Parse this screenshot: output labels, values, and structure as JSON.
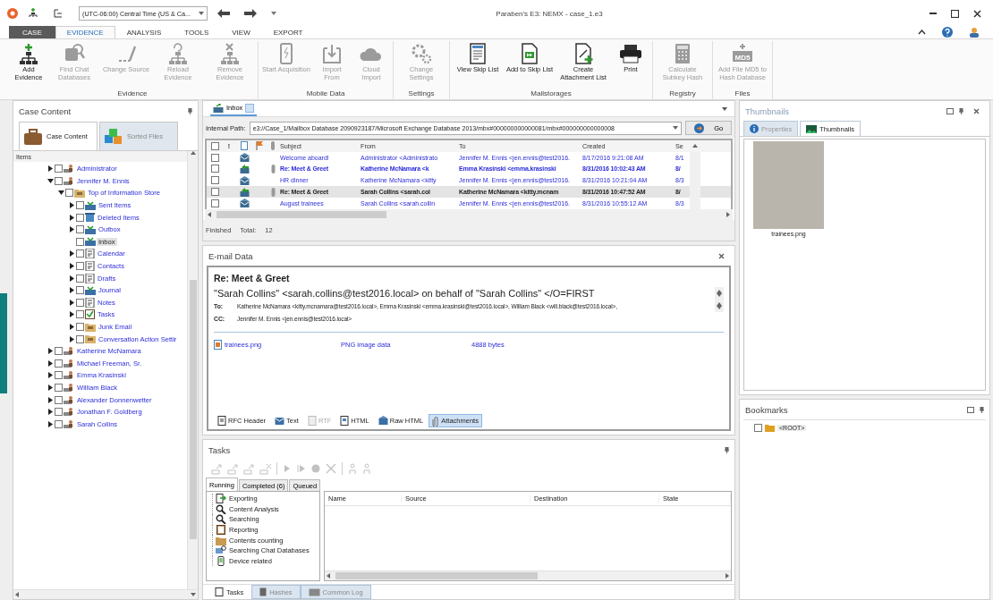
{
  "title_bar": {
    "timezone": "(UTC-06:00) Central Time (US & Ca...",
    "title": "Paraben's E3: NEMX - case_1.e3"
  },
  "ribbon_tabs": [
    {
      "label": "CASE",
      "kind": "file",
      "selected": false
    },
    {
      "label": "EVIDENCE",
      "kind": "tab",
      "selected": true
    },
    {
      "label": "ANALYSIS",
      "kind": "tab",
      "selected": false
    },
    {
      "label": "TOOLS",
      "kind": "tab",
      "selected": false
    },
    {
      "label": "VIEW",
      "kind": "tab",
      "selected": false
    },
    {
      "label": "EXPORT",
      "kind": "tab",
      "selected": false
    }
  ],
  "ribbon_groups": [
    {
      "label": "Evidence",
      "buttons": [
        {
          "label": "Add Evidence",
          "kind": "tree-add",
          "disabled": false
        },
        {
          "label": "Find Chat Databases",
          "kind": "chat-db",
          "disabled": true
        },
        {
          "label": "Change Source",
          "kind": "source",
          "disabled": true
        },
        {
          "label": "Reload Evidence",
          "kind": "tree-reload",
          "disabled": true
        },
        {
          "label": "Remove Evidence",
          "kind": "tree-remove",
          "disabled": true
        }
      ]
    },
    {
      "label": "Mobile Data",
      "buttons": [
        {
          "label": "Start Acquisition",
          "kind": "phone",
          "disabled": true
        },
        {
          "label": "Import From",
          "kind": "import",
          "disabled": true
        },
        {
          "label": "Cloud Import",
          "kind": "cloud",
          "disabled": true
        }
      ]
    },
    {
      "label": "Settings",
      "buttons": [
        {
          "label": "Change Settings",
          "kind": "gears",
          "disabled": true
        }
      ]
    },
    {
      "label": "Mailstorages",
      "buttons": [
        {
          "label": "View Skip List",
          "kind": "list",
          "disabled": false
        },
        {
          "label": "Add to Skip List",
          "kind": "skip-add",
          "disabled": false
        },
        {
          "label": "Create Attachment List",
          "kind": "attach-list",
          "disabled": false
        },
        {
          "label": "Print",
          "kind": "printer",
          "disabled": false
        }
      ]
    },
    {
      "label": "Registry",
      "buttons": [
        {
          "label": "Calculate Subkey Hash",
          "kind": "calculator",
          "disabled": true
        }
      ]
    },
    {
      "label": "Files",
      "buttons": [
        {
          "label": "Add File MD5 to Hash Database",
          "kind": "md5",
          "icon_text": "MD5",
          "disabled": true
        }
      ]
    }
  ],
  "case_content": {
    "title": "Case Content",
    "tabs": [
      {
        "label": "Case Content",
        "selected": true
      },
      {
        "label": "Sorted Files",
        "selected": false
      }
    ],
    "header": "Items",
    "tree": [
      {
        "label": "Administrator",
        "kind": "mailbox",
        "expanded": false,
        "checked": false,
        "selected": false
      },
      {
        "label": "Jennifer M. Ennis",
        "kind": "mailbox",
        "expanded": true,
        "checked": false,
        "selected": false,
        "children": [
          {
            "label": "Top of Information Store",
            "kind": "folder",
            "expanded": true,
            "checked": false,
            "selected": false,
            "children": [
              {
                "label": "Sent Items",
                "kind": "tray",
                "expanded": false,
                "checked": false,
                "selected": false
              },
              {
                "label": "Deleted Items",
                "kind": "bin",
                "expanded": false,
                "checked": false,
                "selected": false
              },
              {
                "label": "Outbox",
                "kind": "tray",
                "expanded": false,
                "checked": false,
                "selected": false
              },
              {
                "label": "Inbox",
                "kind": "tray",
                "checked": false,
                "selected": true
              },
              {
                "label": "Calendar",
                "kind": "page",
                "expanded": false,
                "checked": false,
                "selected": false
              },
              {
                "label": "Contacts",
                "kind": "page",
                "expanded": false,
                "checked": false,
                "selected": false
              },
              {
                "label": "Drafts",
                "kind": "page",
                "expanded": false,
                "checked": false,
                "selected": false
              },
              {
                "label": "Journal",
                "kind": "tray",
                "expanded": false,
                "checked": false,
                "selected": false
              },
              {
                "label": "Notes",
                "kind": "page",
                "expanded": false,
                "checked": false,
                "selected": false
              },
              {
                "label": "Tasks",
                "kind": "tasks",
                "expanded": false,
                "checked": false,
                "selected": false
              },
              {
                "label": "Junk Email",
                "kind": "folder",
                "expanded": false,
                "checked": false,
                "selected": false
              },
              {
                "label": "Conversation Action Settir",
                "kind": "folder",
                "expanded": false,
                "checked": false,
                "selected": false
              }
            ]
          }
        ]
      },
      {
        "label": "Katherine McNamara",
        "kind": "mailbox",
        "expanded": false,
        "checked": false,
        "selected": false
      },
      {
        "label": "Michael Freeman, Sr.",
        "kind": "mailbox",
        "expanded": false,
        "checked": false,
        "selected": false
      },
      {
        "label": "Emma Krasinski",
        "kind": "mailbox",
        "expanded": false,
        "checked": false,
        "selected": false
      },
      {
        "label": "William Black",
        "kind": "mailbox",
        "expanded": false,
        "checked": false,
        "selected": false
      },
      {
        "label": "Alexander Donnenwetter",
        "kind": "mailbox",
        "expanded": false,
        "checked": false,
        "selected": false
      },
      {
        "label": "Jonathan F. Goldberg",
        "kind": "mailbox",
        "expanded": false,
        "checked": false,
        "selected": false
      },
      {
        "label": "Sarah Collins",
        "kind": "mailbox",
        "expanded": false,
        "checked": false,
        "selected": false
      }
    ]
  },
  "mail_list": {
    "tab": "Inbox",
    "path_label": "Internal Path:",
    "path": "e3://Case_1/Mailbox Database 2090923187/Microsoft Exchange Database 2013/mbx#000000000000081/mbx#000000000000008",
    "go": "Go",
    "columns": [
      {
        "kind": "check",
        "checked": false
      },
      {
        "kind": "text",
        "label": "!"
      },
      {
        "kind": "doc"
      },
      {
        "kind": "flag"
      },
      {
        "kind": "clip"
      },
      {
        "kind": "text",
        "label": "Subject"
      },
      {
        "kind": "text",
        "label": "From"
      },
      {
        "kind": "text",
        "label": "To"
      },
      {
        "kind": "text",
        "label": "Created"
      },
      {
        "kind": "text",
        "label": "Se"
      }
    ],
    "rows": [
      {
        "kind": "mail",
        "subject": "Welcome aboard!",
        "from": "Administrator <Administrato",
        "to": "Jennifer M. Ennis <jen.ennis@test2016.",
        "created": "8/17/2016 9:21:08 AM",
        "sent": "8/1",
        "unread": false,
        "attachment": false,
        "checked": false,
        "selected": false
      },
      {
        "kind": "replied",
        "subject": "Re: Meet & Greet",
        "from": "Katherine McNamara <k",
        "to": "Emma Krasinski <emma.krasinski",
        "created": "8/31/2016 10:02:43 AM",
        "sent": "8/",
        "unread": true,
        "attachment": true,
        "checked": false,
        "selected": false
      },
      {
        "kind": "mail",
        "subject": "HR dinner",
        "from": "Katherine McNamara <kitty",
        "to": "Jennifer M. Ennis <jen.ennis@test2016.",
        "created": "8/31/2016 10:21:04 AM",
        "sent": "8/3",
        "unread": false,
        "attachment": false,
        "checked": false,
        "selected": false
      },
      {
        "kind": "replied",
        "subject": "Re: Meet & Greet",
        "from": "Sarah Collins <sarah.col",
        "to": "Katherine McNamara <kitty.mcnam",
        "created": "8/31/2016 10:47:52 AM",
        "sent": "8/",
        "unread": true,
        "attachment": true,
        "checked": false,
        "selected": true
      },
      {
        "kind": "mail",
        "subject": "August trainees",
        "from": "Sarah Collins <sarah.collin",
        "to": "Jennifer M. Ennis <jen.ennis@test2016.",
        "created": "8/31/2016 10:55:12 AM",
        "sent": "8/3",
        "unread": false,
        "attachment": false,
        "checked": false,
        "selected": false
      }
    ],
    "status": "Finished",
    "total_label": "Total:",
    "total": "12"
  },
  "email_data": {
    "title": "E-mail Data",
    "subject": "Re: Meet & Greet",
    "from": "\"Sarah Collins\" <sarah.collins@test2016.local>  on behalf of  \"Sarah Collins\" </O=FIRST",
    "to_label": "To:",
    "to": "Katherine McNamara <kitty.mcnamara@test2016.local>, Emma Krasinski <emma.krasinski@test2016.local>, William Black <will.black@test2016.local>,",
    "cc_label": "CC:",
    "cc": "Jennifer M. Ennis <jen.ennis@test2016.local>",
    "attachments": [
      {
        "name": "trainees.png",
        "type": "PNG image data",
        "size": "4888 bytes"
      }
    ],
    "tabs": [
      {
        "label": "RFC Header",
        "kind": "rfc",
        "selected": false,
        "disabled": false
      },
      {
        "label": "Text",
        "kind": "text",
        "selected": false,
        "disabled": false
      },
      {
        "label": "RTF",
        "kind": "rtf",
        "selected": false,
        "disabled": true
      },
      {
        "label": "HTML",
        "kind": "html",
        "selected": false,
        "disabled": false
      },
      {
        "label": "Raw HTML",
        "kind": "raw",
        "selected": false,
        "disabled": false
      },
      {
        "label": "Attachments",
        "kind": "clip",
        "selected": true,
        "disabled": false
      }
    ]
  },
  "tasks": {
    "title": "Tasks",
    "toolbar": [
      {
        "kind": "tray-arrow",
        "disabled": true
      },
      {
        "kind": "tray-arrow",
        "disabled": true
      },
      {
        "kind": "tray-arrow",
        "disabled": true
      },
      {
        "kind": "tray-x",
        "disabled": true
      },
      {
        "kind": "play",
        "disabled": true
      },
      {
        "kind": "step",
        "disabled": true
      },
      {
        "kind": "record",
        "disabled": true
      },
      {
        "kind": "cancel",
        "disabled": true
      },
      {
        "kind": "person",
        "disabled": true
      },
      {
        "kind": "person",
        "disabled": true
      }
    ],
    "tabs": [
      {
        "label": "Running",
        "selected": true
      },
      {
        "label": "Completed (6)",
        "selected": false
      },
      {
        "label": "Queued",
        "selected": false
      }
    ],
    "categories": [
      {
        "label": "Exporting",
        "kind": "export"
      },
      {
        "label": "Content Analysis",
        "kind": "search"
      },
      {
        "label": "Searching",
        "kind": "search"
      },
      {
        "label": "Reporting",
        "kind": "report"
      },
      {
        "label": "Contents counting",
        "kind": "folder"
      },
      {
        "label": "Searching Chat Databases",
        "kind": "chat"
      },
      {
        "label": "Device related",
        "kind": "phone"
      }
    ],
    "columns": [
      "Name",
      "Source",
      "Destination",
      "State"
    ]
  },
  "bottom_tabs": [
    {
      "label": "Tasks",
      "selected": true
    },
    {
      "label": "Hashes",
      "selected": false
    },
    {
      "label": "Common Log",
      "selected": false
    }
  ],
  "thumbnails": {
    "title": "Thumbnails",
    "tabs": [
      {
        "label": "Properties",
        "kind": "info",
        "selected": false
      },
      {
        "label": "Thumbnails",
        "kind": "image",
        "selected": true
      }
    ],
    "items": [
      {
        "caption": "trainees.png"
      }
    ]
  },
  "bookmarks": {
    "title": "Bookmarks",
    "items": [
      {
        "label": "<ROOT>",
        "checked": false
      }
    ]
  }
}
